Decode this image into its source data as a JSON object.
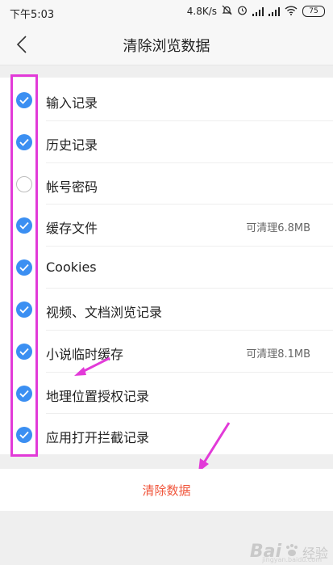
{
  "status_bar": {
    "time": "下午5:03",
    "speed": "4.8K/s",
    "battery": "75"
  },
  "header": {
    "title": "清除浏览数据"
  },
  "items": [
    {
      "label": "输入记录",
      "checked": true,
      "extra": ""
    },
    {
      "label": "历史记录",
      "checked": true,
      "extra": ""
    },
    {
      "label": "帐号密码",
      "checked": false,
      "extra": ""
    },
    {
      "label": "缓存文件",
      "checked": true,
      "extra": "可清理6.8MB"
    },
    {
      "label": "Cookies",
      "checked": true,
      "extra": ""
    },
    {
      "label": "视频、文档浏览记录",
      "checked": true,
      "extra": ""
    },
    {
      "label": "小说临时缓存",
      "checked": true,
      "extra": "可清理8.1MB"
    },
    {
      "label": "地理位置授权记录",
      "checked": true,
      "extra": ""
    },
    {
      "label": "应用打开拦截记录",
      "checked": true,
      "extra": ""
    }
  ],
  "footer": {
    "clear_label": "清除数据"
  },
  "watermark": {
    "logo": "Bai",
    "suffix": "经验",
    "url": "jingyan.baidu.com"
  },
  "colors": {
    "accent": "#3b8ff2",
    "danger": "#f0563c",
    "annotation": "#e23ad8"
  }
}
